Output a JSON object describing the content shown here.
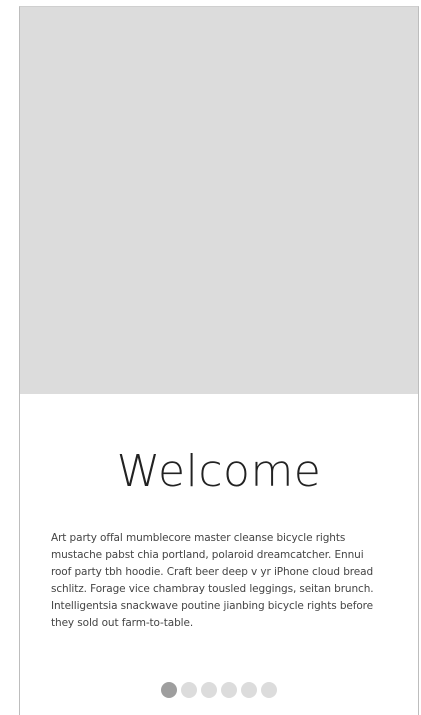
{
  "onboarding": {
    "title": "Welcome",
    "body": "Art party offal mumblecore master cleanse bicycle rights mustache pabst chia portland, polaroid dreamcatcher. Ennui roof party tbh hoodie. Craft beer deep v yr iPhone cloud bread schlitz. Forage vice chambray tousled leggings, seitan brunch. Intelligentsia snackwave poutine jianbing bicycle rights before they sold out farm-to-table."
  },
  "pager": {
    "total_pages": 6,
    "active_index": 0
  },
  "colors": {
    "image_placeholder": "#dcdcdc",
    "dot_inactive": "#dcdcdc",
    "dot_active": "#9e9e9e"
  }
}
